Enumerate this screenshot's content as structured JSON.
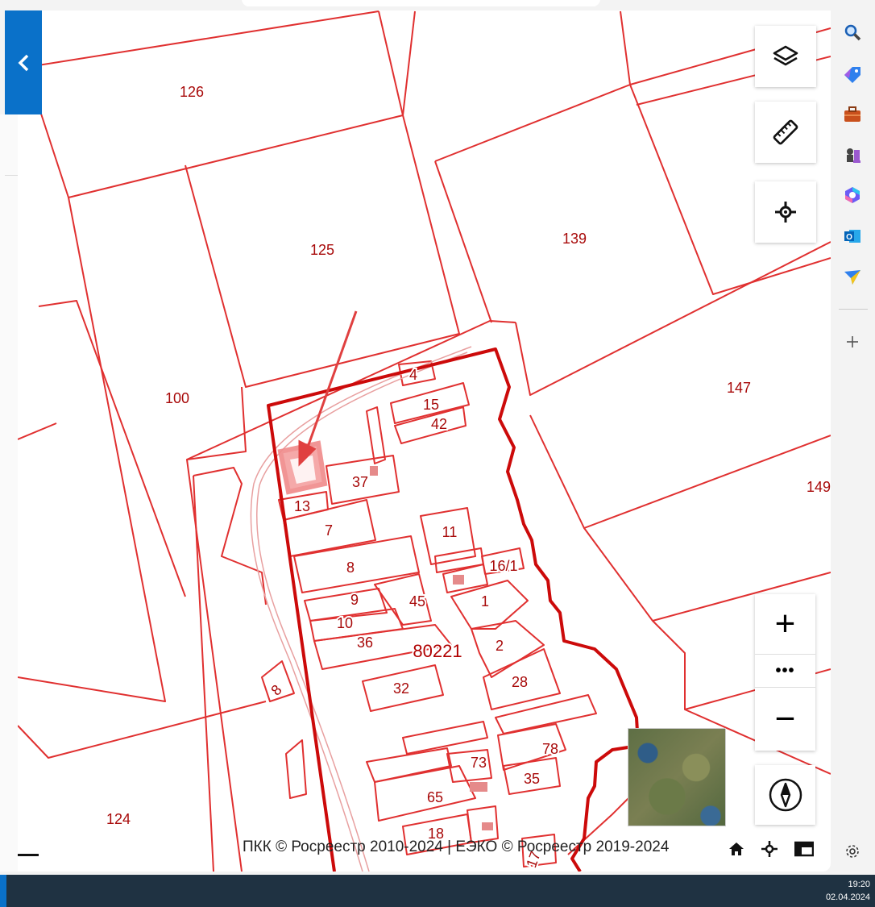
{
  "map": {
    "block_label": "80221",
    "parcels": [
      {
        "label": "126"
      },
      {
        "label": "125"
      },
      {
        "label": "139"
      },
      {
        "label": "100"
      },
      {
        "label": "147"
      },
      {
        "label": "149"
      },
      {
        "label": "124"
      },
      {
        "label": "4"
      },
      {
        "label": "15"
      },
      {
        "label": "42"
      },
      {
        "label": "37"
      },
      {
        "label": "13"
      },
      {
        "label": "7"
      },
      {
        "label": "11"
      },
      {
        "label": "16/1"
      },
      {
        "label": "8"
      },
      {
        "label": "9"
      },
      {
        "label": "45"
      },
      {
        "label": "1"
      },
      {
        "label": "10"
      },
      {
        "label": "36"
      },
      {
        "label": "2"
      },
      {
        "label": "28"
      },
      {
        "label": "32"
      },
      {
        "label": "8"
      },
      {
        "label": "78"
      },
      {
        "label": "73"
      },
      {
        "label": "35"
      },
      {
        "label": "65"
      },
      {
        "label": "18"
      },
      {
        "label": "17"
      }
    ],
    "colors": {
      "boundary": "#d10a0a",
      "parcel_line": "#e03030",
      "highlight": "#f08a8a",
      "label": "#a80a0a"
    }
  },
  "controls": {
    "layers": "layers-icon",
    "ruler": "ruler-icon",
    "locate": "crosshair-icon",
    "zoom_in": "+",
    "more": "•••",
    "zoom_out": "−",
    "compass": "compass-icon"
  },
  "attribution": "ПКК © Росреестр 2010-2024 | ЕЭКО © Росреестр 2019-2024",
  "sidebar_icons": [
    "search-icon",
    "tag-icon",
    "briefcase-icon",
    "chess-icon",
    "copilot-icon",
    "outlook-icon",
    "send-icon",
    "add-icon",
    "settings-icon"
  ],
  "taskbar": {
    "time": "19:20",
    "date": "02.04.2024"
  }
}
